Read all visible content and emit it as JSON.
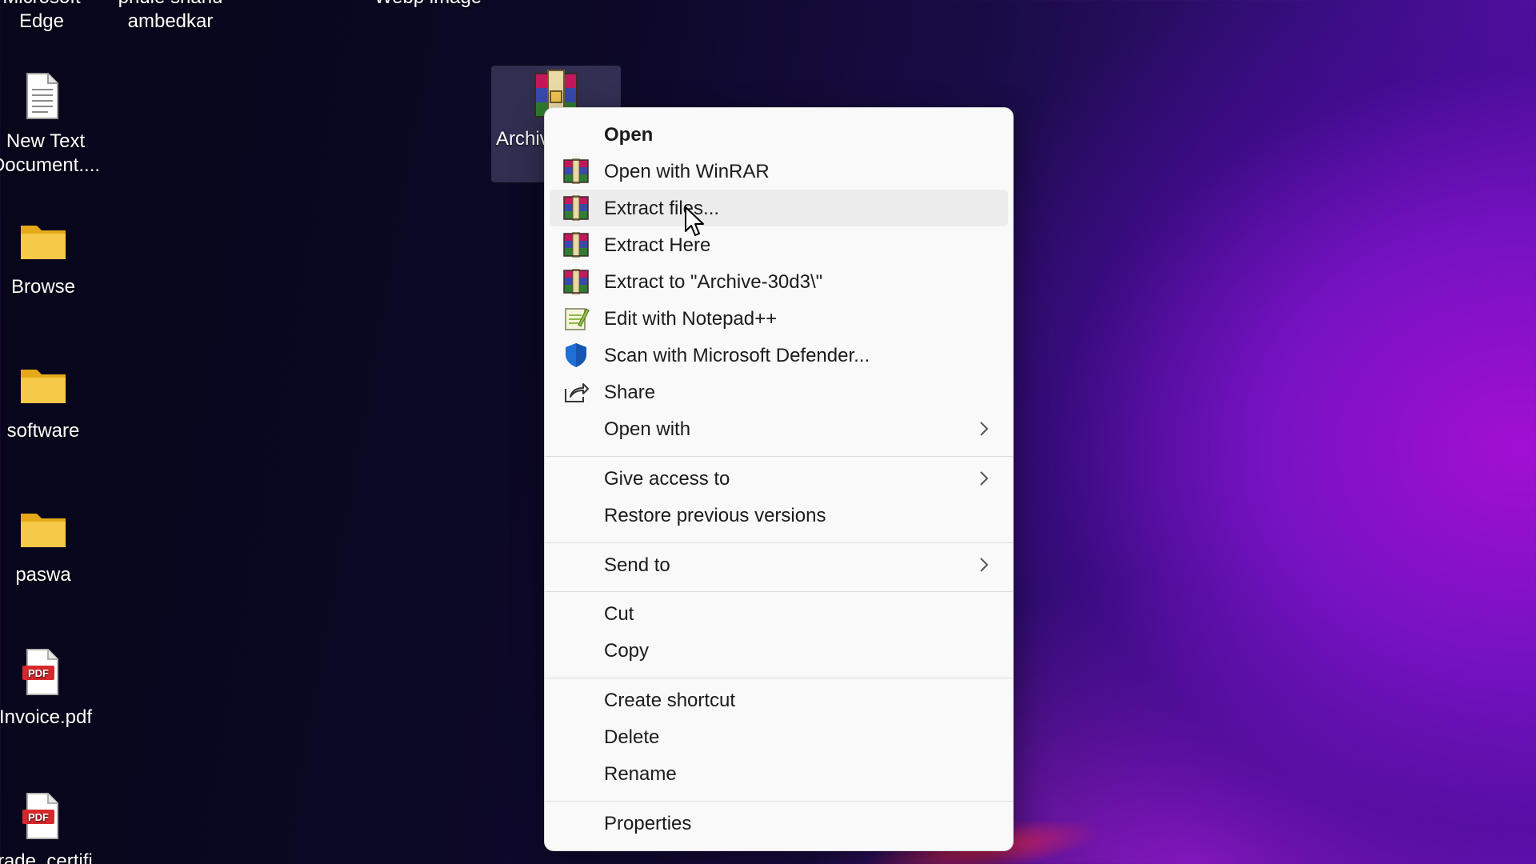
{
  "desktop": {
    "icons": [
      {
        "label": "Microsoft\nEdge",
        "icon": "edge-icon"
      },
      {
        "label": "phule shahu\nambedkar",
        "icon": "folder-icon"
      },
      {
        "label": "Webp image",
        "icon": "file-icon"
      },
      {
        "label": "New Text\nDocument....",
        "icon": "text-document-icon"
      },
      {
        "label": "Browse",
        "icon": "folder-icon"
      },
      {
        "label": "software",
        "icon": "folder-icon"
      },
      {
        "label": "paswa",
        "icon": "folder-icon"
      },
      {
        "label": "Invoice.pdf",
        "icon": "pdf-icon"
      },
      {
        "label": "Grade_certifi...",
        "icon": "pdf-icon"
      },
      {
        "label": "Archive",
        "icon": "winrar-archive-icon"
      }
    ],
    "pdf_badge": "PDF"
  },
  "context_menu": {
    "items": [
      {
        "label": "Open",
        "icon": "",
        "bold": true
      },
      {
        "label": "Open with WinRAR",
        "icon": "winrar-icon"
      },
      {
        "label": "Extract files...",
        "icon": "winrar-icon"
      },
      {
        "label": "Extract Here",
        "icon": "winrar-icon"
      },
      {
        "label": "Extract to \"Archive-30d3\\\"",
        "icon": "winrar-icon"
      },
      {
        "label": "Edit with Notepad++",
        "icon": "notepad-plus-plus-icon"
      },
      {
        "label": "Scan with Microsoft Defender...",
        "icon": "defender-shield-icon"
      },
      {
        "label": "Share",
        "icon": "share-icon"
      },
      {
        "label": "Open with",
        "icon": "",
        "submenu": true
      },
      {
        "label": "Give access to",
        "icon": "",
        "submenu": true
      },
      {
        "label": "Restore previous versions",
        "icon": ""
      },
      {
        "label": "Send to",
        "icon": "",
        "submenu": true
      },
      {
        "label": "Cut",
        "icon": ""
      },
      {
        "label": "Copy",
        "icon": ""
      },
      {
        "label": "Create shortcut",
        "icon": ""
      },
      {
        "label": "Delete",
        "icon": ""
      },
      {
        "label": "Rename",
        "icon": ""
      },
      {
        "label": "Properties",
        "icon": ""
      }
    ],
    "hovered_item": "Extract files..."
  },
  "colors": {
    "menu_background": "#f9f9f9",
    "menu_hover": "#ececec",
    "folder_yellow": "#f5c542",
    "defender_blue": "#1f6fd6",
    "pdf_red": "#d8282c"
  }
}
